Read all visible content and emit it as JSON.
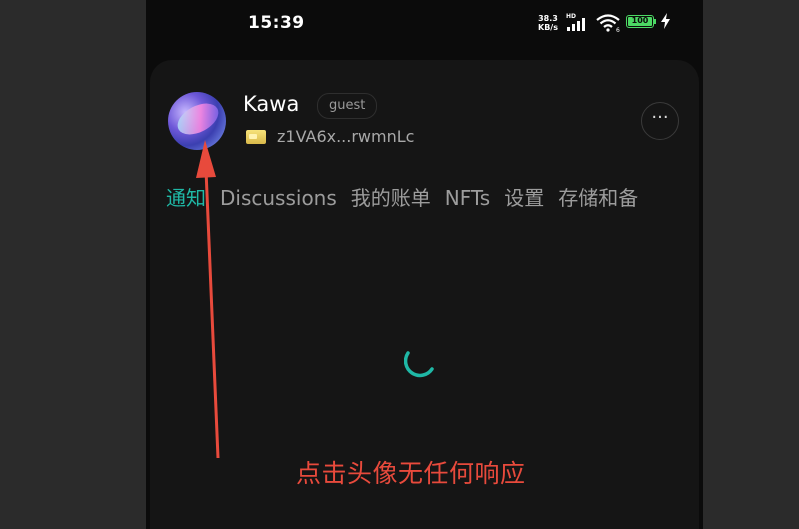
{
  "status_bar": {
    "time": "15:39",
    "net_speed_value": "38.3",
    "net_speed_unit": "KB/s",
    "network_type": "HD",
    "wifi_level": "6",
    "battery": "100"
  },
  "profile": {
    "username": "Kawa",
    "role": "guest",
    "address": "z1VA6x...rwmnLc",
    "more_label": "···"
  },
  "tabs": [
    {
      "label": "通知",
      "active": true
    },
    {
      "label": "Discussions",
      "active": false
    },
    {
      "label": "我的账单",
      "active": false
    },
    {
      "label": "NFTs",
      "active": false
    },
    {
      "label": "设置",
      "active": false
    },
    {
      "label": "存储和备",
      "active": false
    }
  ],
  "annotation": {
    "text": "点击头像无任何响应",
    "color": "#e84a3c"
  },
  "colors": {
    "accent": "#1fb8a6",
    "background": "#0b0b0b",
    "battery": "#4cd964"
  },
  "icons": {
    "signal": "signal-bars-icon",
    "wifi": "wifi-icon",
    "battery": "battery-icon",
    "charge": "lightning-icon",
    "wallet": "wallet-icon",
    "more": "more-dots-icon",
    "loading": "loading-spinner-icon",
    "arrow": "arrow-annotation-icon"
  }
}
